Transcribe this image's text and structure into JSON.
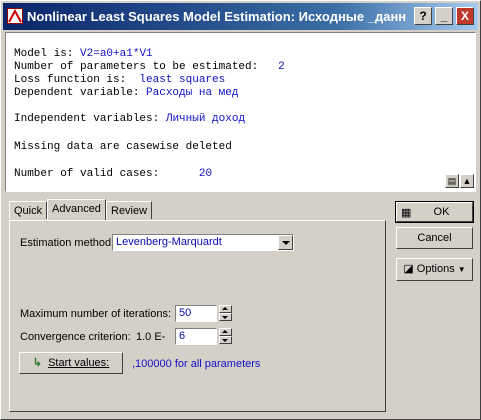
{
  "window": {
    "title": "Nonlinear Least Squares Model Estimation: Исходные _данные _л",
    "help_label": "?",
    "minimize_label": "_",
    "close_label": "X"
  },
  "output": {
    "model_label": "Model is:",
    "model_value": "V2=a0+a1*V1",
    "params_label": "Number of parameters to be estimated:",
    "params_value": "2",
    "loss_label": "Loss function is:",
    "loss_value": "least squares",
    "dep_label": "Dependent variable:",
    "dep_value": "Расходы на мед",
    "indep_label": "Independent variables:",
    "indep_value": "Личный доход",
    "missing_text": "Missing data are casewise deleted",
    "valid_label": "Number of valid cases:",
    "valid_value": "20"
  },
  "tabs": [
    "Quick",
    "Advanced",
    "Review"
  ],
  "panel": {
    "method_label": "Estimation method:",
    "method_value": "Levenberg-Marquardt",
    "max_iter_label": "Maximum number of iterations:",
    "max_iter_value": "50",
    "conv_label": "Convergence criterion:",
    "conv_prefix": "1.0 E-",
    "conv_value": "6",
    "start_label": "Start values:",
    "start_note": ",100000 for all parameters"
  },
  "buttons": {
    "ok": "OK",
    "cancel": "Cancel",
    "options": "Options"
  },
  "colors": {
    "value_text": "#1010c8",
    "title_bar": "#0a246a"
  }
}
